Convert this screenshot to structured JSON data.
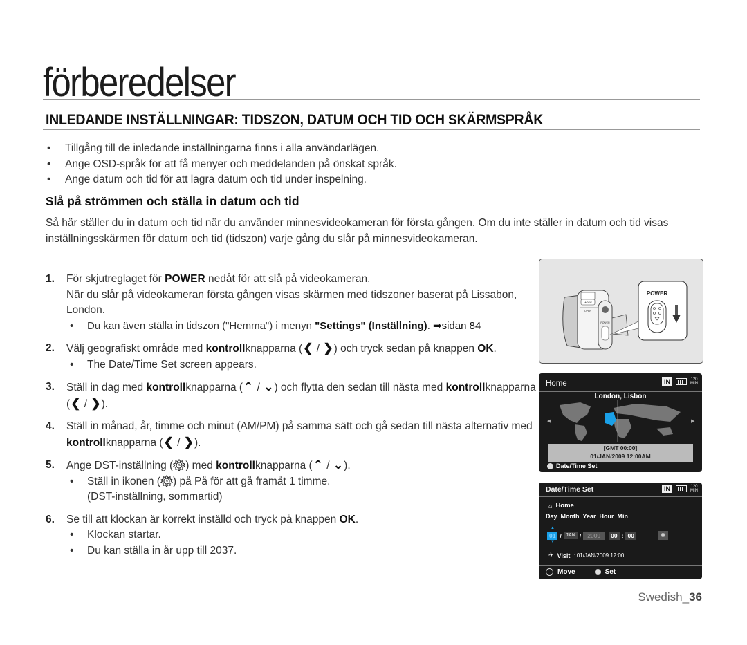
{
  "chapter_title": "förberedelser",
  "section_title": "INLEDANDE INSTÄLLNINGAR: TIDSZON, DATUM OCH TID OCH SKÄRMSPRÅK",
  "intro_bullets": [
    "Tillgång till de inledande inställningarna finns i alla användarlägen.",
    "Ange OSD-språk för att få menyer och meddelanden på önskat språk.",
    "Ange datum och tid för att lagra datum och tid under inspelning."
  ],
  "subsection_title": "Slå på strömmen och ställa in datum och tid",
  "paragraph": "Så här ställer du in datum och tid när du använder minnesvideokameran för första gången. Om du inte ställer in datum och tid visas inställningsskärmen för datum och tid (tidszon) varje gång du slår på minnesvideokameran.",
  "steps": {
    "s1": {
      "num": "1.",
      "a": "För skjutreglaget för ",
      "b": "POWER",
      "c": " nedåt för att slå på videokameran.",
      "d": "När du slår på videokameran första gången visas skärmen med tidszoner baserat på Lissabon, London.",
      "bullet_a": "Du kan även ställa in tidszon (\"Hemma\") i menyn ",
      "bullet_b": "\"Settings\" (Inställning)",
      "bullet_c": ". ",
      "bullet_ref": "➡sidan 84"
    },
    "s2": {
      "num": "2.",
      "a": "Välj geografiskt område med ",
      "b": "kontroll",
      "c": "knapparna (",
      "d": ") och tryck sedan på knappen ",
      "e": "OK",
      "f": ".",
      "bullet": "The Date/Time Set screen appears."
    },
    "s3": {
      "num": "3.",
      "a": "Ställ in dag med ",
      "b": "kontroll",
      "c": "knapparna (",
      "d": ") och flytta den sedan till nästa med ",
      "e": "kontroll",
      "f": "knapparna (",
      "g": ")."
    },
    "s4": {
      "num": "4.",
      "a": "Ställ in månad, år, timme och minut (AM/PM) på samma sätt och gå sedan till nästa alternativ med ",
      "b": "kontroll",
      "c": "knapparna (",
      "d": ")."
    },
    "s5": {
      "num": "5.",
      "a": "Ange DST-inställning (",
      "b": ") med ",
      "c": "kontroll",
      "d": "knapparna (",
      "e": ").",
      "bullet_a": "Ställ in ikonen (",
      "bullet_b": ") på På för att gå framåt 1 timme.",
      "bullet_c": "(DST-inställning, sommartid)"
    },
    "s6": {
      "num": "6.",
      "a": "Se till att klockan är korrekt inställd och tryck på knappen ",
      "b": "OK",
      "c": ".",
      "bullets": [
        "Klockan startar.",
        "Du kan ställa in år upp till 2037."
      ]
    }
  },
  "glyphs": {
    "left": "❮",
    "right": "❯",
    "up": "⌃",
    "down": "⌄",
    "slash": " / "
  },
  "figure_power": {
    "label": "POWER",
    "mode_label": "MODE",
    "open_label": "OPEN",
    "power_small": "POWER"
  },
  "figure_home": {
    "title": "Home",
    "storage": "IN",
    "remaining_top": "120",
    "remaining_bottom": "MIN",
    "city": "London, Lisbon",
    "gmt": "[GMT 00:00]",
    "datetime": "01/JAN/2009 12:00AM",
    "footer": "Date/Time Set",
    "highlight_color": "#1aa0e8"
  },
  "figure_datetime": {
    "title": "Date/Time Set",
    "storage": "IN",
    "remaining_top": "120",
    "remaining_bottom": "MIN",
    "home_label": "Home",
    "columns": [
      "Day",
      "Month",
      "Year",
      "Hour",
      "Min"
    ],
    "day": "01",
    "month": "JAN",
    "year": "2009",
    "hour": "00",
    "minute": "00",
    "visit_label": "Visit",
    "visit_value": ": 01/JAN/2009 12:00",
    "footer_move": "Move",
    "footer_set": "Set",
    "highlight_color": "#1aa0e8"
  },
  "page_footer": {
    "lang": "Swedish_",
    "page": "36"
  }
}
